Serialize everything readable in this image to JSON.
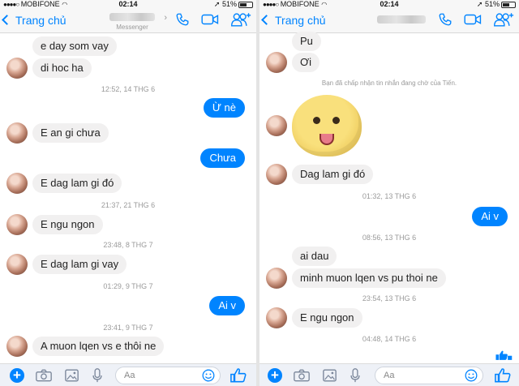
{
  "left": {
    "status": {
      "carrier": "MOBIFONE",
      "time": "02:14",
      "battery": "51%"
    },
    "nav": {
      "back_label": "Trang chủ",
      "subtitle": "Messenger"
    },
    "messages": [
      {
        "kind": "in",
        "text": "e day som vay",
        "avatar": false
      },
      {
        "kind": "in",
        "text": "di hoc ha",
        "avatar": true
      },
      {
        "kind": "ts",
        "text": "12:52, 14 THG 6"
      },
      {
        "kind": "out",
        "text": "Ừ nè"
      },
      {
        "kind": "in",
        "text": "E an gi chưa",
        "avatar": true
      },
      {
        "kind": "out",
        "text": "Chưa"
      },
      {
        "kind": "in",
        "text": "E dag lam gi đó",
        "avatar": true
      },
      {
        "kind": "ts",
        "text": "21:37, 21 THG 6"
      },
      {
        "kind": "in",
        "text": "E ngu ngon",
        "avatar": true
      },
      {
        "kind": "ts",
        "text": "23:48, 8 THG 7"
      },
      {
        "kind": "in",
        "text": "E dag lam gi vay",
        "avatar": true
      },
      {
        "kind": "ts",
        "text": "01:29, 9 THG 7"
      },
      {
        "kind": "out",
        "text": "Ai v"
      },
      {
        "kind": "ts",
        "text": "23:41, 9 THG 7"
      },
      {
        "kind": "in",
        "text": "A muon lqen vs e thôi ne",
        "avatar": true
      }
    ],
    "composer": {
      "placeholder": "Aa"
    }
  },
  "right": {
    "status": {
      "carrier": "MOBIFONE",
      "time": "02:14",
      "battery": "51%"
    },
    "nav": {
      "back_label": "Trang chủ"
    },
    "messages": [
      {
        "kind": "in",
        "text": "Pu",
        "avatar": false
      },
      {
        "kind": "in",
        "text": "Ơi",
        "avatar": true
      },
      {
        "kind": "sys",
        "text": "Bạn đã chấp nhận tin nhắn đang chờ của Tiến."
      },
      {
        "kind": "sticker",
        "avatar": true
      },
      {
        "kind": "in",
        "text": "Dag lam gi đó",
        "avatar": true
      },
      {
        "kind": "ts",
        "text": "01:32, 13 THG 6"
      },
      {
        "kind": "out",
        "text": "Ai v"
      },
      {
        "kind": "ts",
        "text": "08:56, 13 THG 6"
      },
      {
        "kind": "in",
        "text": "ai dau",
        "avatar": false
      },
      {
        "kind": "in",
        "text": "minh muon lqen vs pu thoi ne",
        "avatar": true
      },
      {
        "kind": "ts",
        "text": "23:54, 13 THG 6"
      },
      {
        "kind": "in",
        "text": "E ngu ngon",
        "avatar": true
      },
      {
        "kind": "ts",
        "text": "04:48, 14 THG 6"
      }
    ],
    "composer": {
      "placeholder": "Aa"
    }
  },
  "colors": {
    "accent": "#0084ff",
    "bubble_in": "#f1f0f0",
    "timestamp": "#9a9a9a"
  },
  "icons": [
    "chevron-left-icon",
    "phone-icon",
    "video-camera-icon",
    "add-people-icon",
    "plus-icon",
    "camera-icon",
    "image-icon",
    "microphone-icon",
    "emoji-icon",
    "thumbs-up-icon"
  ]
}
